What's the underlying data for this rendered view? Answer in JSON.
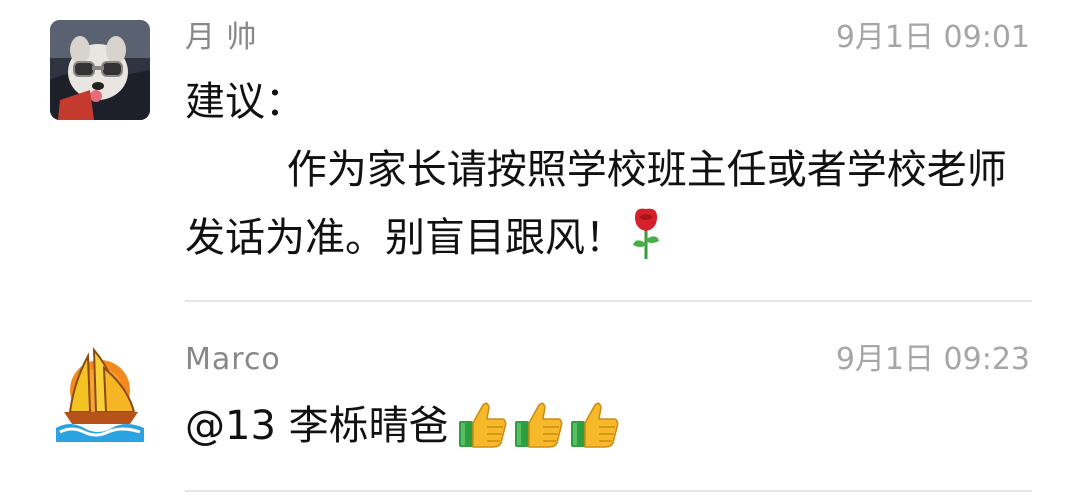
{
  "comments": [
    {
      "name": "月 帅",
      "time": "9月1日 09:01",
      "text": "建议：\n        作为家长请按照学校班主任或者学校老师发话为准。别盲目跟风！",
      "emoji": "rose-icon",
      "avatar": "dog-with-goggles-avatar"
    },
    {
      "name": "Marco",
      "time": "9月1日 09:23",
      "text": "@13 李栎晴爸",
      "emoji": "thumbs-up-icon",
      "emoji_count": 3,
      "avatar": "junk-boat-avatar"
    }
  ],
  "colors": {
    "name": "#888888",
    "time": "#a6a6a6",
    "text": "#111111",
    "divider": "#e6e6e6"
  }
}
